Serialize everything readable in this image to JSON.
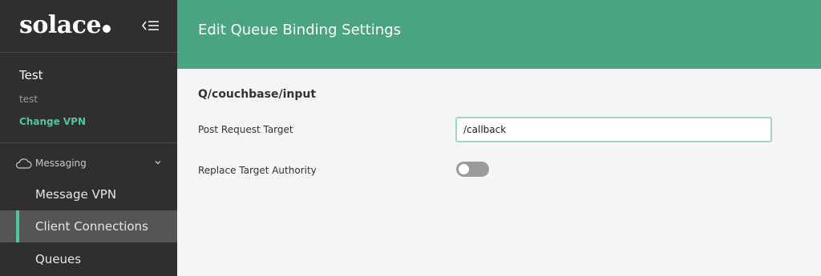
{
  "sidebar": {
    "logo_text": "solace",
    "vpn": {
      "name": "Test",
      "sub": "test",
      "change_label": "Change VPN"
    },
    "section": {
      "label": "Messaging"
    },
    "items": [
      {
        "label": "Message VPN"
      },
      {
        "label": "Client Connections",
        "active": true
      },
      {
        "label": "Queues"
      }
    ]
  },
  "header": {
    "title": "Edit Queue Binding Settings"
  },
  "form": {
    "queue_name": "Q/couchbase/input",
    "post_request_target": {
      "label": "Post Request Target",
      "value": "/callback"
    },
    "replace_target_authority": {
      "label": "Replace Target Authority",
      "enabled": false
    }
  },
  "colors": {
    "sidebar_bg": "#2f2f2f",
    "header_bg": "#4aa47f",
    "accent": "#4fc89a",
    "toggle_off": "#9b9b9b"
  },
  "icons": {
    "collapse": "collapse-menu-icon",
    "messaging": "cloud-icon",
    "section_toggle": "chevron-down-icon"
  }
}
